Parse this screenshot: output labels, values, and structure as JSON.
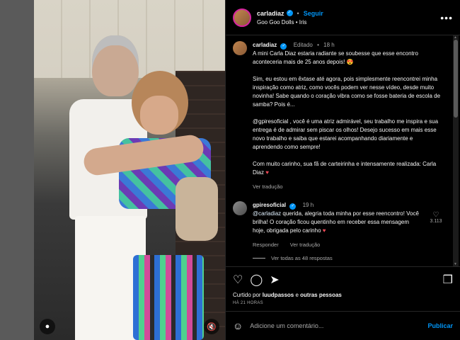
{
  "header": {
    "username": "carladiaz",
    "follow_label": "Seguir",
    "song": "Goo Goo Dolls • Iris",
    "more_icon": "•••"
  },
  "caption": {
    "username": "carladiaz",
    "edited": "Editado",
    "time": "18 h",
    "paragraphs": [
      "A mini Carla Diaz estaria radiante se soubesse que esse encontro aconteceria mais de 25 anos depois! 😍",
      "Sim, eu estou em êxtase até agora, pois simplesmente reencontrei minha inspiração como atriz, como vocês podem ver nesse vídeo, desde muito novinha! Sabe quando o coração vibra como se fosse bateria de escola de samba? Pois é...",
      "@gpiresoficial , você é uma atriz admirável, seu trabalho me inspira e sua entrega é de admirar sem piscar os olhos! Desejo sucesso em mais esse novo trabalho e saiba que estarei acompanhando diariamente e aprendendo como sempre!",
      "Com muito carinho, sua fã de carteirinha e intensamente realizada: Carla Diaz"
    ],
    "heart": "♥",
    "see_translation": "Ver tradução"
  },
  "comment": {
    "username": "gpiresoficial",
    "time": "19 h",
    "mention": "@carladiaz",
    "text": " querida, alegria toda minha por esse reencontro! Você brilha! O coração ficou quentinho em receber essa mensagem hoje, obrigada pelo carinho",
    "heart": "♥",
    "reply_label": "Responder",
    "see_translation": "Ver tradução",
    "likes": "3.113",
    "view_replies": "Ver todas as 48 respostas"
  },
  "footer": {
    "liked_prefix": "Curtido por ",
    "liked_user": "luudpassos",
    "liked_middle": " e ",
    "liked_others": "outras pessoas",
    "time": "HÁ 21 HORAS",
    "comment_placeholder": "Adicione um comentário...",
    "post_label": "Publicar"
  },
  "colors": {
    "accent": "#0095f6",
    "heart": "#ed4956",
    "background": "#000000"
  }
}
